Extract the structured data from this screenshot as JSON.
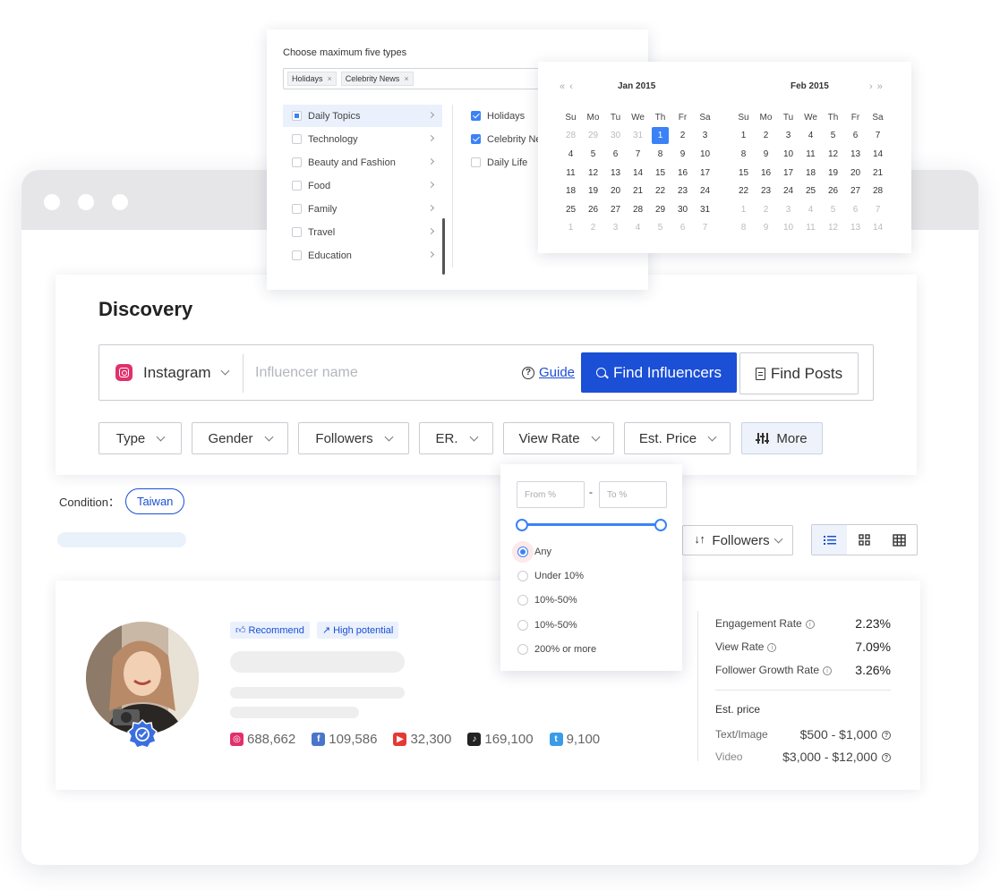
{
  "discovery": {
    "title": "Discovery",
    "platform": "Instagram",
    "search_placeholder": "Influencer name",
    "guide_label": "Guide",
    "find_influencers_label": "Find Influencers",
    "find_posts_label": "Find Posts",
    "filters": [
      "Type",
      "Gender",
      "Followers",
      "ER.",
      "View Rate",
      "Est. Price"
    ],
    "more_label": "More"
  },
  "condition": {
    "label": "Condition：",
    "chip": "Taiwan"
  },
  "sort": {
    "label": "Followers"
  },
  "view_rate_panel": {
    "from_placeholder": "From %",
    "to_placeholder": "To %",
    "dash": "-",
    "options": [
      "Any",
      "Under 10%",
      "10%-50%",
      "10%-50%",
      "200% or more"
    ],
    "selected_index": 0
  },
  "types_panel": {
    "title": "Choose maximum five types",
    "selected_chips": [
      "Holidays",
      "Celebrity News"
    ],
    "categories": [
      "Daily Topics",
      "Technology",
      "Beauty and Fashion",
      "Food",
      "Family",
      "Travel",
      "Education"
    ],
    "subcategories": [
      {
        "label": "Holidays",
        "checked": true
      },
      {
        "label": "Celebrity News",
        "checked": true
      },
      {
        "label": "Daily Life",
        "checked": false
      }
    ]
  },
  "calendar": {
    "weekdays": [
      "Su",
      "Mo",
      "Tu",
      "We",
      "Th",
      "Fr",
      "Sa"
    ],
    "months": [
      {
        "title": "Jan  2015",
        "days": [
          "28",
          "29",
          "30",
          "31",
          "1",
          "2",
          "3",
          "4",
          "5",
          "6",
          "7",
          "8",
          "9",
          "10",
          "11",
          "12",
          "13",
          "14",
          "15",
          "16",
          "17",
          "18",
          "19",
          "20",
          "21",
          "22",
          "23",
          "24",
          "25",
          "26",
          "27",
          "28",
          "29",
          "30",
          "31",
          "1",
          "2",
          "3",
          "4",
          "5",
          "6",
          "7"
        ],
        "first_in_month": 4,
        "last_in_month": 34,
        "selected": 4
      },
      {
        "title": "Feb  2015",
        "days": [
          "1",
          "2",
          "3",
          "4",
          "5",
          "6",
          "7",
          "8",
          "9",
          "10",
          "11",
          "12",
          "13",
          "14",
          "15",
          "16",
          "17",
          "18",
          "19",
          "20",
          "21",
          "22",
          "23",
          "24",
          "25",
          "26",
          "27",
          "28",
          "1",
          "2",
          "3",
          "4",
          "5",
          "6",
          "7",
          "8",
          "9",
          "10",
          "11",
          "12",
          "13",
          "14"
        ],
        "first_in_month": 0,
        "last_in_month": 27,
        "selected": -1
      }
    ],
    "nav_prev": "« ‹",
    "nav_next": "› »"
  },
  "influencer": {
    "tags": [
      "Recommend",
      "High potential"
    ],
    "socials": [
      {
        "icon": "instagram-icon",
        "color": "#e1306c",
        "value": "688,662"
      },
      {
        "icon": "facebook-icon",
        "color": "#4a76c9",
        "value": "109,586"
      },
      {
        "icon": "youtube-icon",
        "color": "#e53935",
        "value": "32,300"
      },
      {
        "icon": "tiktok-icon",
        "color": "#222222",
        "value": "169,100"
      },
      {
        "icon": "twitter-icon",
        "color": "#3a9be8",
        "value": "9,100"
      }
    ],
    "metrics": [
      {
        "label": "Engagement Rate",
        "value": "2.23%"
      },
      {
        "label": "View Rate",
        "value": "7.09%"
      },
      {
        "label": "Follower Growth Rate",
        "value": "3.26%"
      }
    ],
    "est_price_title": "Est. price",
    "prices": [
      {
        "label": "Text/Image",
        "value": "$500 - $1,000"
      },
      {
        "label": "Video",
        "value": "$3,000 - $12,000"
      }
    ]
  },
  "colors": {
    "accent": "#1a4fd6",
    "check": "#3b82f6",
    "tag_bg": "#eaf1fc"
  }
}
